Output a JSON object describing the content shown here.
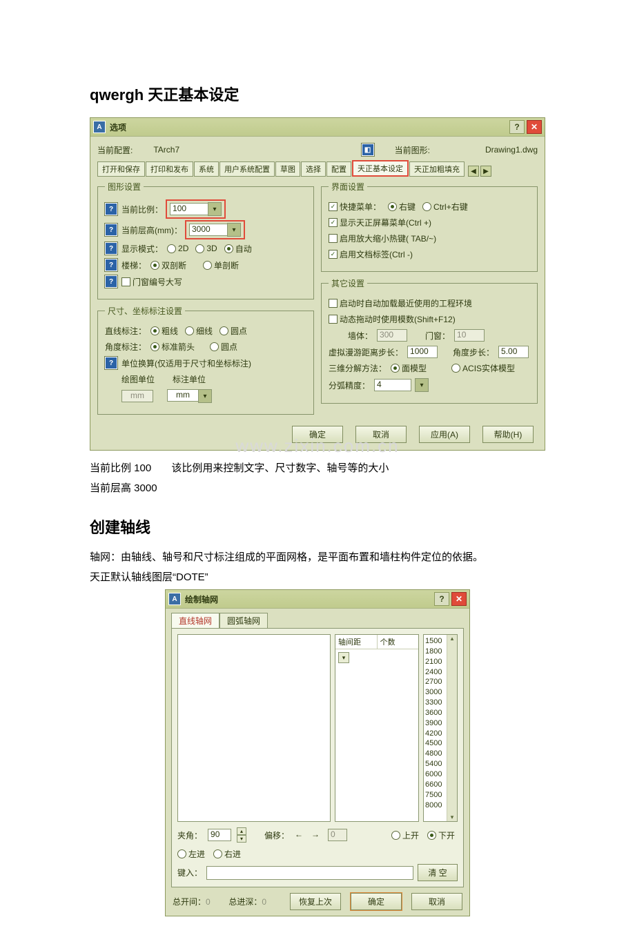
{
  "doc": {
    "heading1": "qwergh 天正基本设定",
    "heading2": "创建轴线",
    "note_scale": "当前比例 100",
    "note_scale_desc": "该比例用来控制文字、尺寸数字、轴号等的大小",
    "note_layer": "当前层高 3000",
    "axis_desc1": "轴网：由轴线、轴号和尺寸标注组成的平面网格，是平面布置和墙柱构件定位的依据。",
    "axis_desc2": "天正默认轴线图层“DOTE”",
    "watermark": "www.zixin.com.cn"
  },
  "options_dialog": {
    "title": "选项",
    "cfg_label": "当前配置:",
    "cfg_value": "TArch7",
    "drawing_label": "当前图形:",
    "drawing_value": "Drawing1.dwg",
    "tabs": [
      "打开和保存",
      "打印和发布",
      "系统",
      "用户系统配置",
      "草图",
      "选择",
      "配置",
      "天正基本设定",
      "天正加粗填充"
    ],
    "active_tab_index": 7,
    "graphic_settings": {
      "legend": "图形设置",
      "cur_scale_label": "当前比例：",
      "cur_scale_value": "100",
      "cur_height_label": "当前层高(mm)：",
      "cur_height_value": "3000",
      "disp_mode_label": "显示模式：",
      "disp_mode_opts": [
        "2D",
        "3D",
        "自动"
      ],
      "disp_mode_sel": 2,
      "stair_label": "楼梯：",
      "stair_opts": [
        "双剖断",
        "单剖断"
      ],
      "stair_sel": 0,
      "window_num_upper": "门窗编号大写"
    },
    "dim_settings": {
      "legend": "尺寸、坐标标注设置",
      "line_label": "直线标注：",
      "line_opts": [
        "粗线",
        "细线",
        "圆点"
      ],
      "line_sel": 0,
      "angle_label": "角度标注：",
      "angle_opts": [
        "标准箭头",
        "圆点"
      ],
      "angle_sel": 0,
      "unit_note": "单位换算(仅适用于尺寸和坐标标注)",
      "unit_draw_label": "绘图单位",
      "unit_dim_label": "标注单位",
      "unit_draw_value": "mm",
      "unit_dim_value": "mm"
    },
    "ui_settings": {
      "legend": "界面设置",
      "shortcut_label": "快捷菜单：",
      "shortcut_opts": [
        "右键",
        "Ctrl+右键"
      ],
      "shortcut_sel": 0,
      "chk_screen_menu": "显示天正屏幕菜单(Ctrl +)",
      "chk_zoom_hotkey": "启用放大缩小热键( TAB/~)",
      "chk_doc_tabs": "启用文档标签(Ctrl -)"
    },
    "other_settings": {
      "legend": "其它设置",
      "chk_auto_load": "启动时自动加载最近使用的工程环境",
      "chk_dyn_drag": "动态拖动时使用模数(Shift+F12)",
      "wall_label": "墙体：",
      "wall_value": "300",
      "door_label": "门窗：",
      "door_value": "10",
      "roam_step_label": "虚拟漫游距离步长：",
      "roam_step_value": "1000",
      "angle_step_label": "角度步长：",
      "angle_step_value": "5.00",
      "decomp_label": "三维分解方法：",
      "decomp_opts": [
        "面模型",
        "ACIS实体模型"
      ],
      "decomp_sel": 0,
      "arc_label": "分弧精度：",
      "arc_value": "4"
    },
    "buttons": {
      "ok": "确定",
      "cancel": "取消",
      "apply": "应用(A)",
      "help": "帮助(H)"
    }
  },
  "axis_dialog": {
    "title": "绘制轴网",
    "tabs": [
      "直线轴网",
      "圆弧轴网"
    ],
    "active_tab_index": 0,
    "col_headers": [
      "轴间距",
      "个数"
    ],
    "numbers": [
      "1500",
      "1800",
      "2100",
      "2400",
      "2700",
      "3000",
      "3300",
      "3600",
      "3900",
      "4200",
      "4500",
      "4800",
      "5400",
      "6000",
      "6600",
      "7500",
      "8000"
    ],
    "angle_label": "夹角：",
    "angle_value": "90",
    "offset_label": "偏移：",
    "offset_value": "0",
    "dir_opts": [
      "上开",
      "下开",
      "左进",
      "右进"
    ],
    "dir_sel": 1,
    "input_label": "键入：",
    "clear_btn": "清 空",
    "total_open_label": "总开间：",
    "total_open_value": "0",
    "total_depth_label": "总进深：",
    "total_depth_value": "0",
    "restore_btn": "恢复上次",
    "ok_btn": "确定",
    "cancel_btn": "取消"
  }
}
